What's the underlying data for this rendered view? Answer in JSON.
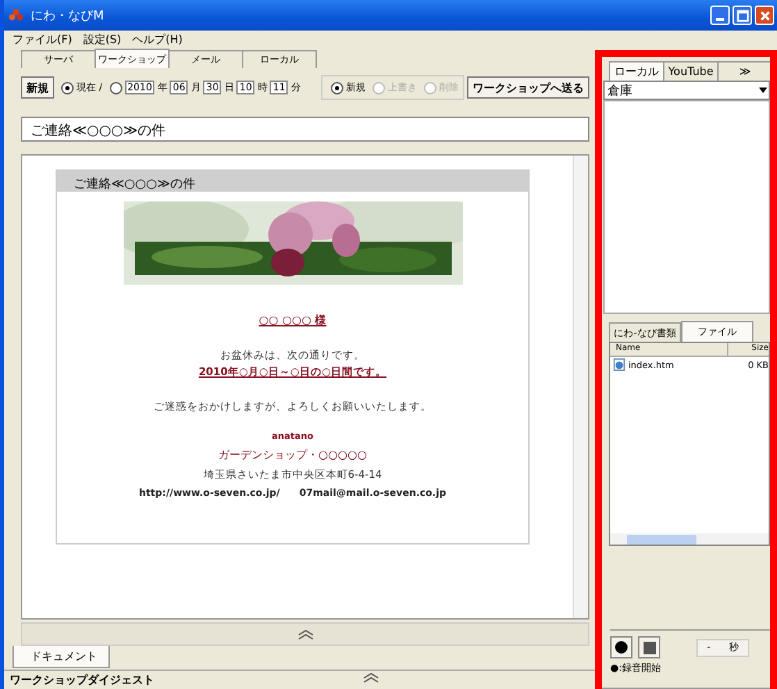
{
  "window": {
    "title": "にわ・なびM"
  },
  "menu": [
    "ファイル(F)",
    "設定(S)",
    "ヘルプ(H)"
  ],
  "tabs": [
    {
      "label": "サーバ",
      "selected": false
    },
    {
      "label": "ワークショップ",
      "selected": true
    },
    {
      "label": "メール",
      "selected": false
    },
    {
      "label": "ローカル",
      "selected": false
    }
  ],
  "toolbar": {
    "new_button": "新規",
    "time_modes": [
      {
        "label": "現在 /",
        "selected": true
      },
      {
        "selected": false
      }
    ],
    "datetime": [
      {
        "value": "2010",
        "unit": "年"
      },
      {
        "value": "06",
        "unit": "月"
      },
      {
        "value": "30",
        "unit": "日"
      },
      {
        "value": "10",
        "unit": "時"
      },
      {
        "value": "11",
        "unit": "分"
      }
    ],
    "modes": [
      {
        "label": "新規",
        "selected": true,
        "disabled": false
      },
      {
        "label": "上書き",
        "selected": false,
        "disabled": true
      },
      {
        "label": "削除",
        "selected": false,
        "disabled": true
      }
    ],
    "send_button": "ワークショップへ送る"
  },
  "subject": "ご連絡≪○○○≫の件",
  "document": {
    "header": "ご連絡≪○○○≫の件",
    "banner": {
      "kind": "picture"
    },
    "lines": [
      {
        "kind": "name",
        "text": "○○ ○○○ 様"
      },
      {
        "kind": "plain",
        "text": "お盆休みは、次の通りです。"
      },
      {
        "kind": "emphasis",
        "text": "2010年○月○日～○日の○日間です。"
      },
      {
        "kind": "plain",
        "text": "ご迷惑をおかけしますが、よろしくお願いいたします。"
      },
      {
        "kind": "sign",
        "text": "anatano"
      },
      {
        "kind": "shop",
        "text": "ガーデンショップ・○○○○○"
      },
      {
        "kind": "address",
        "text": "埼玉県さいたま市中央区本町6-4-14"
      }
    ],
    "contacts": [
      "http://www.o-seven.co.jp/",
      "07mail@mail.o-seven.co.jp"
    ]
  },
  "bottom_tabs": [
    {
      "label": "ドキュメント",
      "selected": true
    }
  ],
  "digest_title": "ワークショップダイジェスト",
  "side": {
    "tabs": [
      {
        "label": "ローカル",
        "selected": true
      },
      {
        "label": "YouTube",
        "selected": false
      },
      {
        "label": "≫",
        "selected": false
      }
    ],
    "folder": "倉庫",
    "file_tabs": [
      {
        "label": "にわ-なび書類",
        "selected": false
      },
      {
        "label": "ファイル",
        "selected": true
      }
    ],
    "columns": [
      "Name",
      "Size"
    ],
    "files": [
      {
        "name": "index.htm",
        "size": "0 KB"
      }
    ],
    "seconds": "-",
    "seconds_unit": "秒",
    "record_hint": "●:録音開始"
  }
}
